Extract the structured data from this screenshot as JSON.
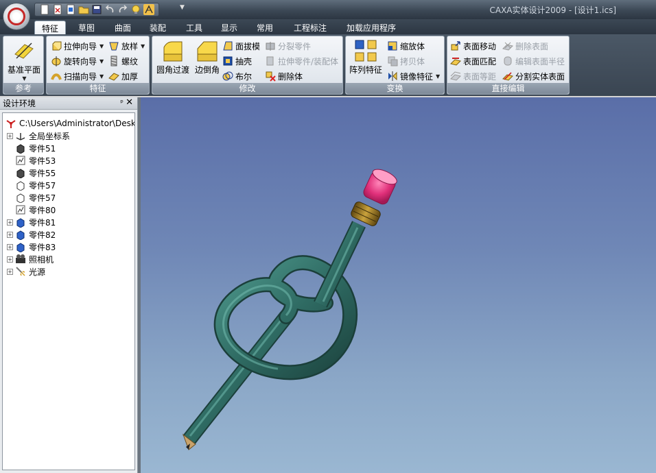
{
  "app": {
    "title": "CAXA实体设计2009 - [设计1.ics]"
  },
  "tabs": [
    {
      "label": "特征",
      "active": true
    },
    {
      "label": "草图"
    },
    {
      "label": "曲面"
    },
    {
      "label": "装配"
    },
    {
      "label": "工具"
    },
    {
      "label": "显示"
    },
    {
      "label": "常用"
    },
    {
      "label": "工程标注"
    },
    {
      "label": "加载应用程序"
    }
  ],
  "ribbon": {
    "reference": {
      "label": "参考",
      "datum_plane": "基准平面"
    },
    "feature": {
      "label": "特征",
      "extrude": "拉伸向导",
      "revolve": "旋转向导",
      "sweep": "扫描向导",
      "loft": "放样",
      "thread": "螺纹",
      "thicken": "加厚"
    },
    "modify": {
      "label": "修改",
      "fillet": "圆角过渡",
      "chamfer": "边倒角",
      "draft": "面拔模",
      "shell": "抽壳",
      "boolean": "布尔",
      "split": "分裂零件",
      "extend": "拉伸零件/装配体",
      "delete_body": "删除体"
    },
    "transform": {
      "label": "变换",
      "pattern": "阵列特征",
      "scale": "缩放体",
      "copy": "拷贝体",
      "mirror": "镜像特征"
    },
    "direct": {
      "label": "直接编辑",
      "move_face": "表面移动",
      "match_face": "表面匹配",
      "offset_face": "表面等距",
      "delete_face": "删除表面",
      "edit_radius": "编辑表面半径",
      "split_solid": "分割实体表面"
    }
  },
  "panel": {
    "title": "设计环境",
    "pin": "ᵖ",
    "close": "✕",
    "root": "C:\\Users\\Administrator\\Desk",
    "items": [
      {
        "label": "全局坐标系",
        "icon": "axes-icon",
        "expandable": true
      },
      {
        "label": "零件51",
        "icon": "part-solid-icon",
        "expandable": false
      },
      {
        "label": "零件53",
        "icon": "part-sketch-icon",
        "expandable": false
      },
      {
        "label": "零件55",
        "icon": "part-solid-icon",
        "expandable": false
      },
      {
        "label": "零件57",
        "icon": "part-outline-icon",
        "expandable": false
      },
      {
        "label": "零件57",
        "icon": "part-outline-icon",
        "expandable": false
      },
      {
        "label": "零件80",
        "icon": "part-sketch-icon",
        "expandable": false
      },
      {
        "label": "零件81",
        "icon": "part-blue-icon",
        "expandable": true
      },
      {
        "label": "零件82",
        "icon": "part-blue-icon",
        "expandable": true
      },
      {
        "label": "零件83",
        "icon": "part-blue-icon",
        "expandable": true
      },
      {
        "label": "照相机",
        "icon": "camera-icon",
        "expandable": true
      },
      {
        "label": "光源",
        "icon": "light-icon",
        "expandable": true
      }
    ]
  },
  "viewport": {
    "model": "knotted-pencil",
    "colors": {
      "body": "#2f6b63",
      "eraser": "#e0307a",
      "ferrule": "#8a6a1c",
      "wood": "#c9a36b"
    }
  }
}
